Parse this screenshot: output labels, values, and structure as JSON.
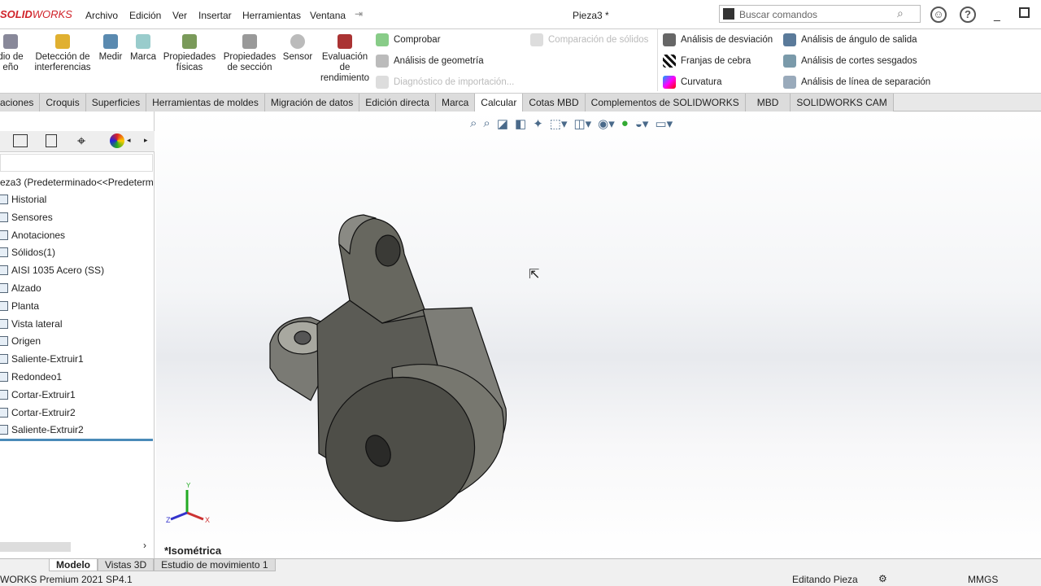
{
  "app": {
    "logo": "SOLIDWORKS",
    "title": "Pieza3 *"
  },
  "menu": [
    "Archivo",
    "Edición",
    "Ver",
    "Insertar",
    "Herramientas",
    "Ventana"
  ],
  "search": {
    "placeholder": "Buscar comandos"
  },
  "ribbon": {
    "large": [
      {
        "label": "dio de\neño"
      },
      {
        "label": "Detección de\ninterferencias"
      },
      {
        "label": "Medir"
      },
      {
        "label": "Marca"
      },
      {
        "label": "Propiedades\nfísicas"
      },
      {
        "label": "Propiedades\nde sección"
      },
      {
        "label": "Sensor"
      },
      {
        "label": "Evaluación\nde\nrendimiento"
      }
    ],
    "col1": [
      "Comprobar",
      "Análisis de geometría",
      "Diagnóstico de importación..."
    ],
    "col2": [
      "Comparación de sólidos"
    ],
    "col3": [
      "Análisis de desviación",
      "Franjas de cebra",
      "Curvatura"
    ],
    "col4": [
      "Análisis de ángulo de salida",
      "Análisis de cortes sesgados",
      "Análisis de línea de separación"
    ]
  },
  "tabs": [
    "aciones",
    "Croquis",
    "Superficies",
    "Herramientas de moldes",
    "Migración de datos",
    "Edición directa",
    "Marca",
    "Calcular",
    "Cotas MBD",
    "Complementos de SOLIDWORKS",
    "MBD",
    "SOLIDWORKS CAM"
  ],
  "active_tab": "Calcular",
  "tree": {
    "root": "eza3  (Predeterminado<<Predeterm",
    "items": [
      "Historial",
      "Sensores",
      "Anotaciones",
      "Sólidos(1)",
      "AISI 1035 Acero (SS)",
      "Alzado",
      "Planta",
      "Vista lateral",
      "Origen",
      "Saliente-Extruir1",
      "Redondeo1",
      "Cortar-Extruir1",
      "Cortar-Extruir2",
      "Saliente-Extruir2"
    ]
  },
  "viewport": {
    "view_name": "*Isométrica",
    "axes": {
      "x": "X",
      "y": "Y",
      "z": "Z"
    }
  },
  "bottom_tabs": [
    "Modelo",
    "Vistas 3D",
    "Estudio de movimiento 1"
  ],
  "status": {
    "version": "WORKS Premium 2021 SP4.1",
    "mode": "Editando Pieza",
    "units": "MMGS"
  }
}
